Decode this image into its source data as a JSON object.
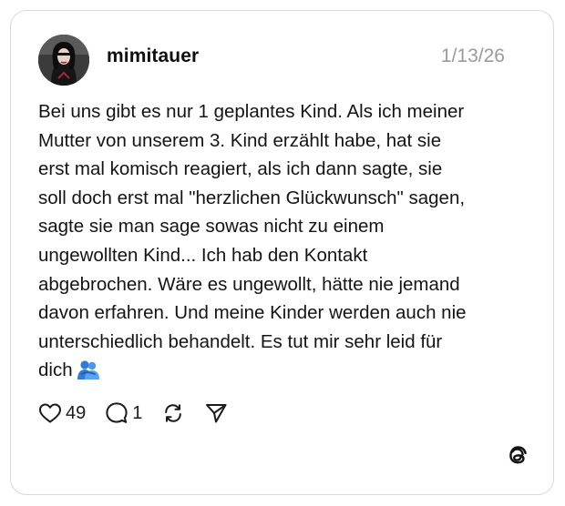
{
  "post": {
    "username": "mimitauer",
    "date": "1/13/26",
    "text": "Bei uns gibt es nur 1 geplantes Kind. Als ich meiner\nMutter von unserem 3. Kind erzählt habe, hat sie\nerst mal komisch reagiert, als ich dann sagte, sie\nsoll doch erst mal \"herzlichen Glückwunsch\" sagen,\nsagte sie man sage sowas nicht zu einem\nungewollten Kind... Ich hab den Kontakt\nabgebrochen. Wäre es ungewollt, hätte nie jemand\ndavon erfahren. Und meine Kinder werden auch nie\nunterschiedlich behandelt. Es tut mir sehr leid für\ndich",
    "emoji": "people-hugging-emoji"
  },
  "actions": {
    "like_count": "49",
    "reply_count": "1",
    "like_icon": "heart-icon",
    "reply_icon": "comment-icon",
    "repost_icon": "repost-icon",
    "share_icon": "send-icon"
  },
  "brand": {
    "logo": "threads-logo"
  },
  "colors": {
    "text": "#141414",
    "muted": "#9a9a9a",
    "border": "#d9d9d9",
    "emoji": "#3f8be6"
  }
}
